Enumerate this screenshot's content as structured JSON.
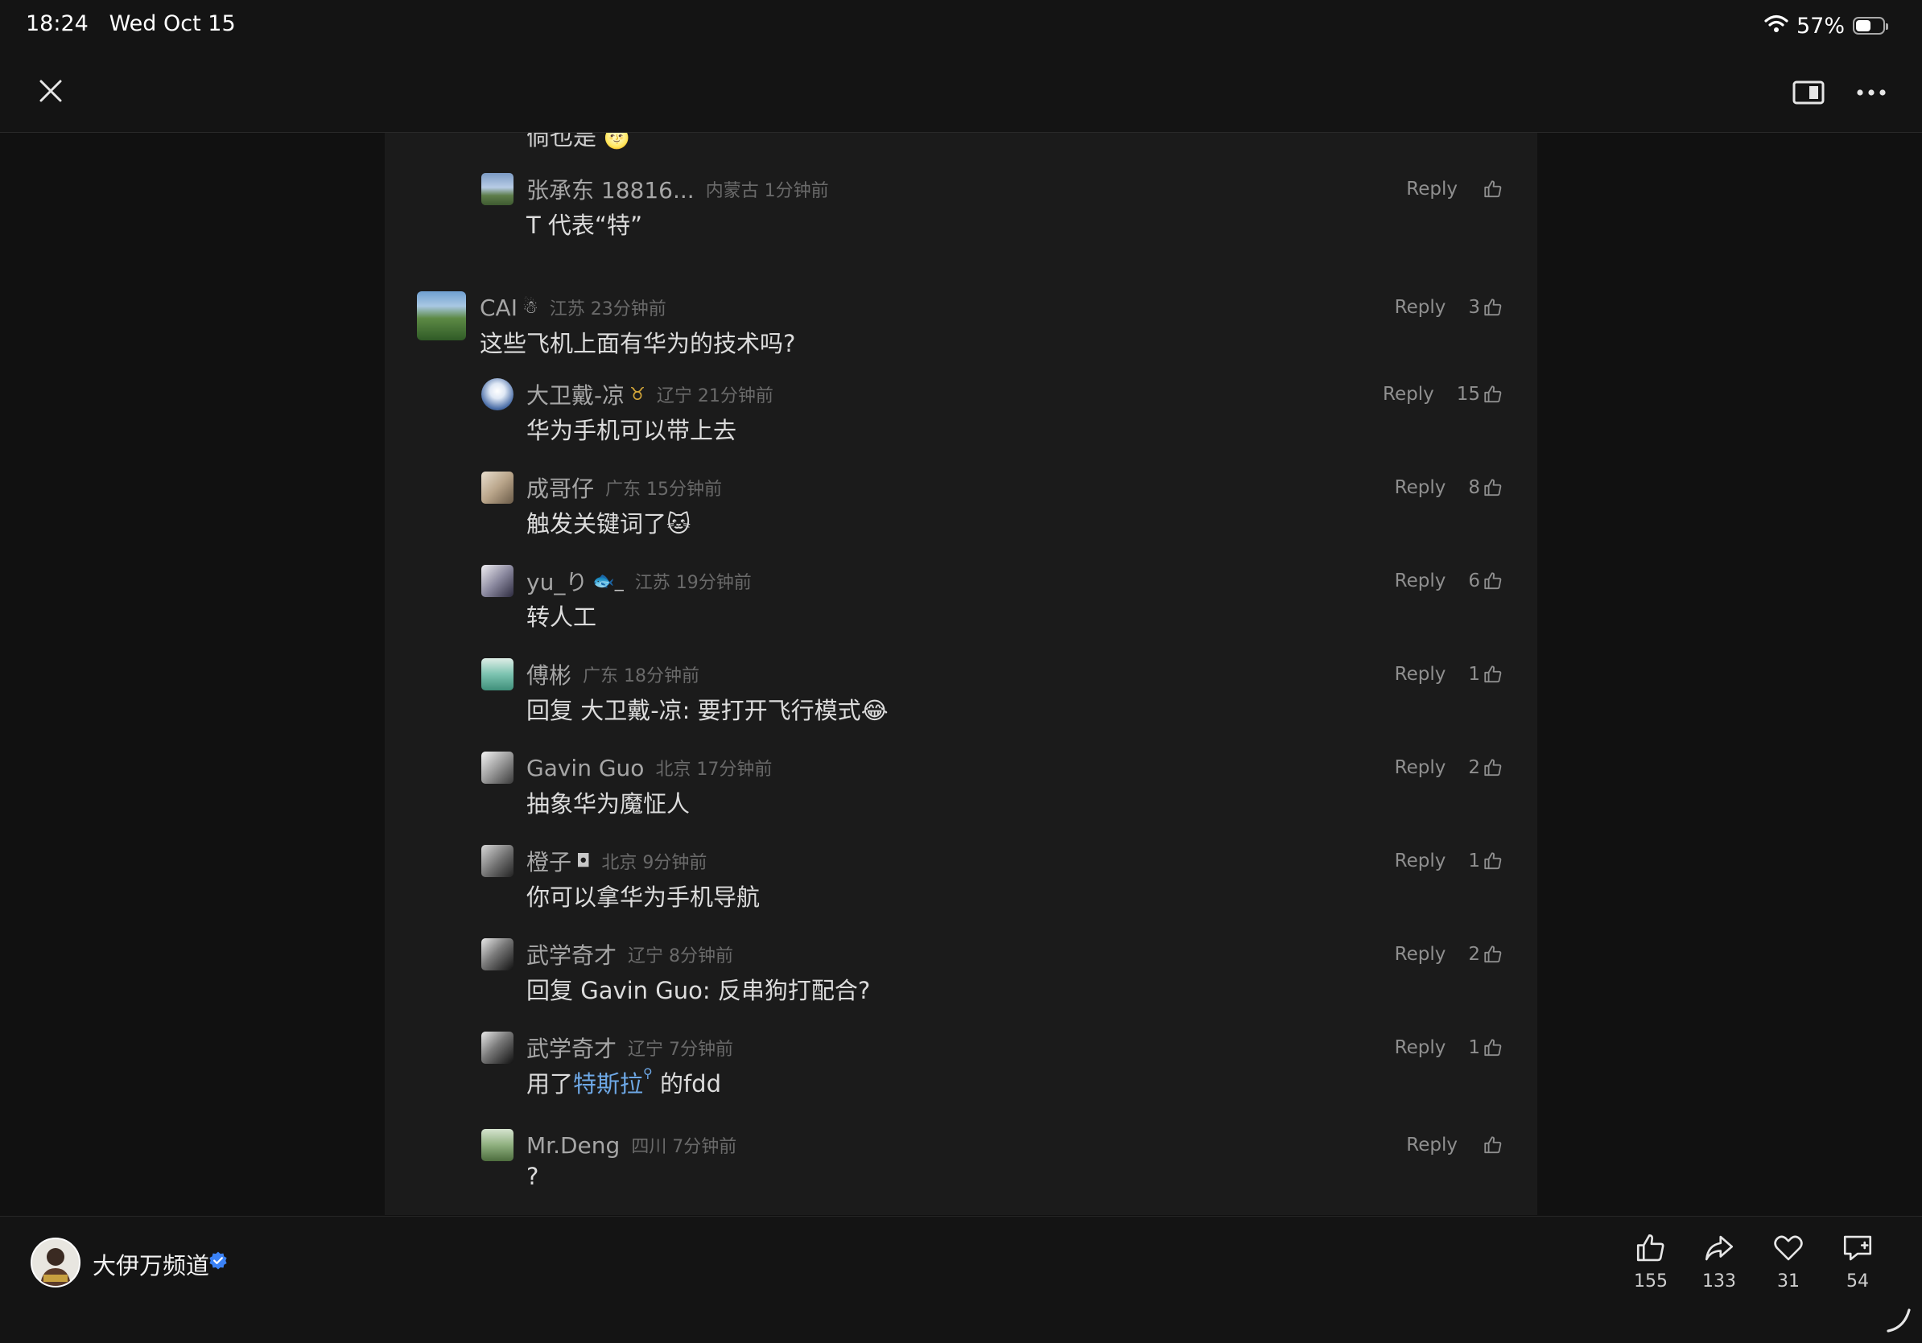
{
  "status_bar": {
    "time": "18:24",
    "date": "Wed Oct 15",
    "battery": "57%",
    "battery_level": 0.57
  },
  "top_bar": {
    "close_icon": "close-icon",
    "split_icon": "split-view-icon",
    "more_icon": "more-icon"
  },
  "partial_comment": "倘也是",
  "reply_label": "Reply",
  "comments": [
    {
      "username": "张承东 18816...",
      "badge": "",
      "location": "内蒙古 1分钟前",
      "text": "T 代表“特”",
      "likes": ""
    },
    {
      "username": "CAI",
      "badge": "☃",
      "location": "江苏 23分钟前",
      "text": "这些飞机上面有华为的技术吗?",
      "likes": "3"
    },
    {
      "username": "大卫戴-凉",
      "badge": "♉",
      "location": "辽宁 21分钟前",
      "text": "华为手机可以带上去",
      "likes": "15"
    },
    {
      "username": "成哥仔",
      "badge": "",
      "location": "广东 15分钟前",
      "text": "触发关键词了",
      "text_emoji": "🐱",
      "likes": "8"
    },
    {
      "username": "yu_り",
      "badge": "🐟_",
      "location": "江苏 19分钟前",
      "text": "转人工",
      "likes": "6"
    },
    {
      "username": "傅彬",
      "badge": "",
      "location": "广东 18分钟前",
      "text": "回复 大卫戴-凉: 要打开飞行模式",
      "text_emoji": "😂",
      "likes": "1"
    },
    {
      "username": "Gavin Guo",
      "badge": "",
      "location": "北京 17分钟前",
      "text": "抽象华为魔怔人",
      "likes": "2"
    },
    {
      "username": "橙子",
      "badge": "◘",
      "location": "北京 9分钟前",
      "text": "你可以拿华为手机导航",
      "likes": "1"
    },
    {
      "username": "武学奇才",
      "badge": "",
      "location": "辽宁 8分钟前",
      "text": "回复 Gavin Guo: 反串狗打配合?",
      "likes": "2"
    },
    {
      "username": "武学奇才",
      "badge": "",
      "location": "辽宁 7分钟前",
      "text_before": "用了",
      "text_link": "特斯拉",
      "text_sup": "⚲",
      "text_after": " 的fdd",
      "likes": "1"
    },
    {
      "username": "Mr.Deng",
      "badge": "",
      "location": "四川 7分钟前",
      "text": "?",
      "likes": ""
    }
  ],
  "bottom_bar": {
    "channel_name": "大伊万频道",
    "verified_icon": "verified-badge-icon",
    "stats": [
      {
        "icon": "thumbs-up-icon",
        "value": "155"
      },
      {
        "icon": "share-icon",
        "value": "133"
      },
      {
        "icon": "heart-icon",
        "value": "31"
      },
      {
        "icon": "comment-add-icon",
        "value": "54"
      }
    ]
  }
}
